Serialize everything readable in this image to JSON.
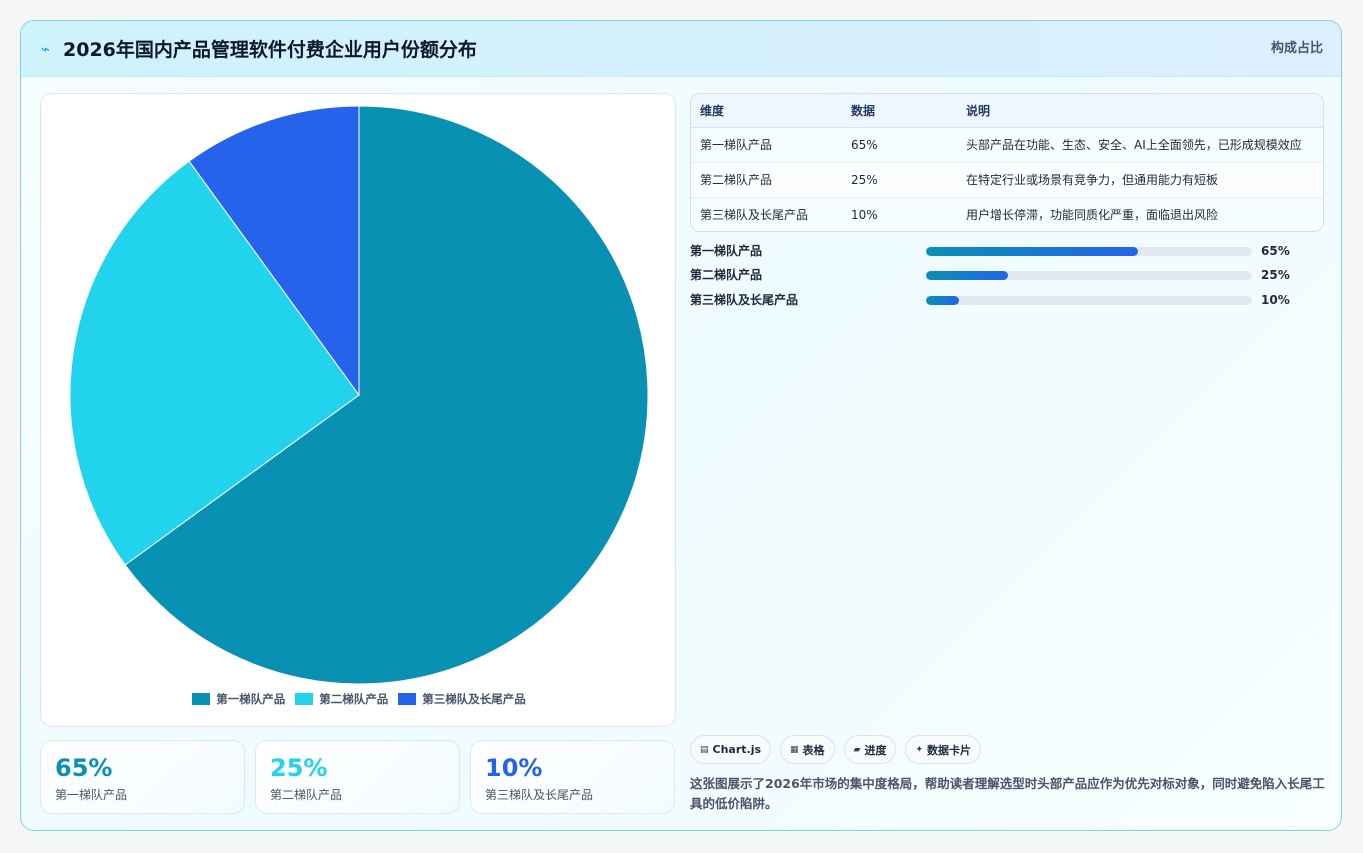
{
  "header": {
    "title": "2026年国内产品管理软件付费企业用户份额分布",
    "tag": "构成占比"
  },
  "colors": {
    "tier1": "#0891b2",
    "tier2": "#22d3ee",
    "tier3": "#2563eb"
  },
  "chart_data": {
    "type": "pie",
    "categories": [
      "第一梯队产品",
      "第二梯队产品",
      "第三梯队及长尾产品"
    ],
    "values": [
      65,
      25,
      10
    ],
    "colors": [
      "#0891b2",
      "#22d3ee",
      "#2563eb"
    ],
    "legend_position": "bottom"
  },
  "stats": [
    {
      "value": "65%",
      "label": "第一梯队产品"
    },
    {
      "value": "25%",
      "label": "第二梯队产品"
    },
    {
      "value": "10%",
      "label": "第三梯队及长尾产品"
    }
  ],
  "table": {
    "headers": [
      "维度",
      "数据",
      "说明"
    ],
    "rows": [
      [
        "第一梯队产品",
        "65%",
        "头部产品在功能、生态、安全、AI上全面领先，已形成规模效应"
      ],
      [
        "第二梯队产品",
        "25%",
        "在特定行业或场景有竞争力，但通用能力有短板"
      ],
      [
        "第三梯队及长尾产品",
        "10%",
        "用户增长停滞，功能同质化严重，面临退出风险"
      ]
    ]
  },
  "progress": [
    {
      "label": "第一梯队产品",
      "value": 65,
      "display": "65%"
    },
    {
      "label": "第二梯队产品",
      "value": 25,
      "display": "25%"
    },
    {
      "label": "第三梯队及长尾产品",
      "value": 10,
      "display": "10%"
    }
  ],
  "chips": [
    {
      "icon": "chart-icon",
      "label": "Chart.js"
    },
    {
      "icon": "table-icon",
      "label": "表格"
    },
    {
      "icon": "progress-icon",
      "label": "进度"
    },
    {
      "icon": "sparkle-icon",
      "label": "数据卡片"
    }
  ],
  "description": "这张图展示了2026年市场的集中度格局，帮助读者理解选型时头部产品应作为优先对标对象，同时避免陷入长尾工具的低价陷阱。"
}
